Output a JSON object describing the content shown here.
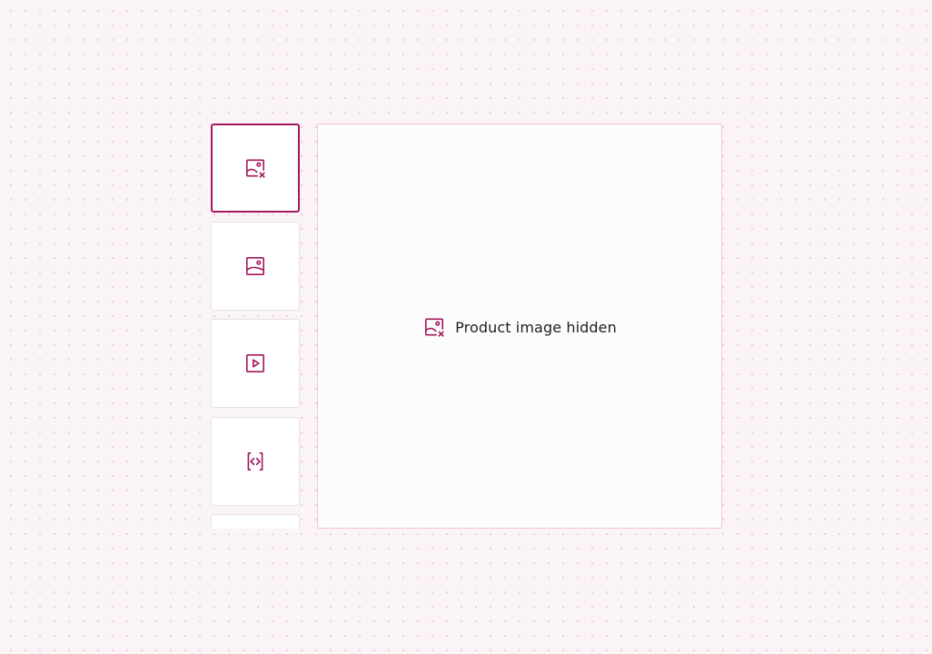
{
  "colors": {
    "accent": "#a3175e",
    "page_background": "#fbf4f7",
    "dot_pattern": "#f0c9da",
    "thumb_border": "#e6dfe4",
    "viewer_border": "#f1c6d8",
    "text": "#1e1e24"
  },
  "gallery": {
    "thumbnails": [
      {
        "icon": "image-hidden-icon",
        "selected": true
      },
      {
        "icon": "image-icon",
        "selected": false
      },
      {
        "icon": "video-play-icon",
        "selected": false
      },
      {
        "icon": "code-embed-icon",
        "selected": false
      },
      {
        "icon": "image-icon",
        "selected": false
      }
    ],
    "viewer": {
      "icon": "image-hidden-icon",
      "message": "Product image hidden"
    }
  }
}
